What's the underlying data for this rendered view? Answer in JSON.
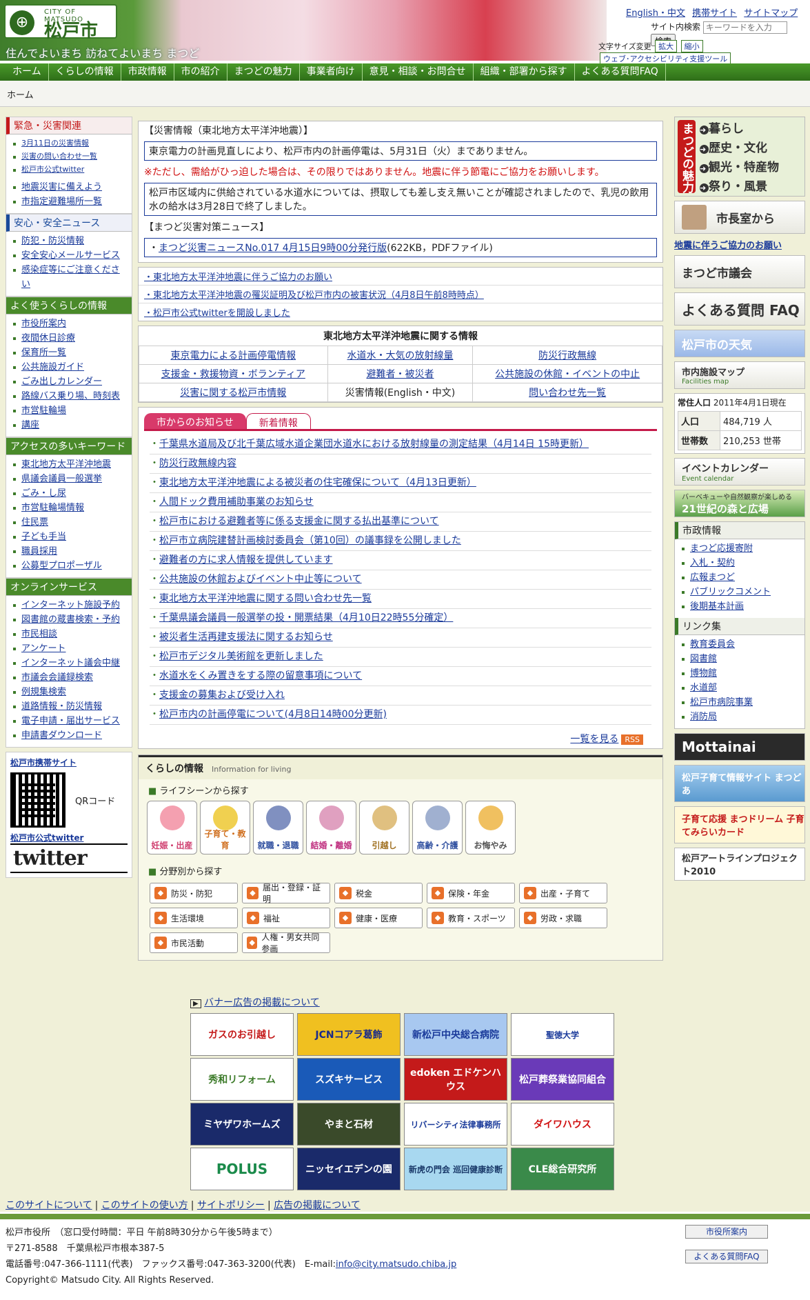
{
  "header": {
    "city_en": "CITY OF MATSUDO",
    "city_jp": "松戸市",
    "catch": "住んでよいまち 訪ねてよいまち まつど",
    "topnav": [
      "English・中文",
      "携帯サイト",
      "サイトマップ"
    ],
    "search_label": "サイト内検索",
    "search_placeholder": "キーワードを入力",
    "search_btn": "検索",
    "font_label": "文字サイズ変更",
    "font_up": "拡大",
    "font_down": "縮小",
    "access_btn": "ウェブ･アクセシビリティ支援ツール"
  },
  "gnav": [
    "ホーム",
    "くらしの情報",
    "市政情報",
    "市の紹介",
    "まつどの魅力",
    "事業者向け",
    "意見・相談・お問合せ",
    "組織・部署から探す",
    "よくある質問FAQ"
  ],
  "breadcrumb": "ホーム",
  "left": {
    "emergency": {
      "title": "緊急・災害関連",
      "items": [
        "3月11日の災害情報",
        "災害の問い合わせ一覧",
        "松戸市公式twitter"
      ],
      "items2": [
        "地震災害に備えよう",
        "市指定避難場所一覧"
      ]
    },
    "safety": {
      "title": "安心・安全ニュース",
      "items": [
        "防犯・防災情報",
        "安全安心メールサービス",
        "感染症等にご注意ください"
      ]
    },
    "often": {
      "title": "よく使うくらしの情報",
      "items": [
        "市役所案内",
        "夜間休日診療",
        "保育所一覧",
        "公共施設ガイド",
        "ごみ出しカレンダー",
        "路線バス乗り場、時刻表",
        "市営駐輪場",
        "講座"
      ]
    },
    "keywords": {
      "title": "アクセスの多いキーワード",
      "items": [
        "東北地方太平洋沖地震",
        "県議会議員一般選挙",
        "ごみ・し尿",
        "市営駐輪場情報",
        "住民票",
        "子ども手当",
        "職員採用",
        "公募型プロポーザル"
      ]
    },
    "online": {
      "title": "オンラインサービス",
      "items": [
        "インターネット施設予約",
        "図書館の蔵書検索・予約",
        "市民相談",
        "アンケート",
        "インターネット議会中継",
        "市議会会議録検索",
        "例規集検索",
        "道路情報・防災情報",
        "電子申請・届出サービス",
        "申請書ダウンロード"
      ]
    },
    "mobile": {
      "title": "松戸市携帯サイト",
      "qr": "QRコード",
      "twitter_title": "松戸市公式twitter",
      "twitter_logo": "twitter"
    }
  },
  "disaster": {
    "head": "【災害情報（東北地方太平洋沖地震）】",
    "power": "東京電力の計画見直しにより、松戸市内の計画停電は、5月31日（火）までありません。",
    "warn": "※ただし、需給がひっ迫した場合は、その限りではありません。地震に伴う節電にご協力をお願いします。",
    "water": "松戸市区域内に供給されている水道水については、摂取しても差し支え無いことが確認されましたので、乳児の飲用水の給水は3月28日で終了しました。",
    "news_head": "【まつど災害対策ニュース】",
    "news_link": "まつど災害ニュースNo.017 4月15日9時00分発行版",
    "news_meta": "(622KB，PDFファイル)",
    "links": [
      "東北地方太平洋沖地震に伴うご協力のお願い",
      "東北地方太平洋沖地震の罹災証明及び松戸市内の被害状況（4月8日午前8時時点）",
      "松戸市公式twitterを開設しました"
    ]
  },
  "info_table": {
    "title": "東北地方太平洋沖地震に関する情報",
    "rows": [
      [
        "東京電力による計画停電情報",
        "水道水・大気の放射線量",
        "防災行政無線"
      ],
      [
        "支援金・救援物資・ボランティア",
        "避難者・被災者",
        "公共施設の休館・イベントの中止"
      ],
      [
        "災害に関する松戸市情報",
        "災害情報(English・中文)",
        "問い合わせ先一覧"
      ]
    ]
  },
  "news": {
    "tab1": "市からのお知らせ",
    "tab2": "新着情報",
    "items": [
      "千葉県水道局及び北千葉広域水道企業団水道水における放射線量の測定結果（4月14日 15時更新）",
      "防災行政無線内容",
      "東北地方太平洋沖地震による被災者の住宅確保について（4月13日更新）",
      "人間ドック費用補助事業のお知らせ",
      "松戸市における避難者等に係る支援金に関する払出基準について",
      "松戸市立病院建替計画検討委員会（第10回）の議事録を公開しました",
      "避難者の方に求人情報を提供しています",
      "公共施設の休館およびイベント中止等について",
      "東北地方太平洋沖地震に関する問い合わせ先一覧",
      "千葉県議会議員一般選挙の投・開票結果（4月10日22時55分確定）",
      "被災者生活再建支援法に関するお知らせ",
      "松戸市デジタル美術館を更新しました",
      "水道水をくみ置きをする際の留意事項について",
      "支援金の募集および受け入れ",
      "松戸市内の計画停電について(4月8日14時00分更新)"
    ],
    "more": "一覧を見る",
    "rss": "RSS"
  },
  "kurashi": {
    "title": "くらしの情報",
    "sub": "Information for living",
    "life_head": "ライフシーンから探す",
    "life": [
      "妊娠・出産",
      "子育て・教育",
      "就職・退職",
      "結婚・離婚",
      "引越し",
      "高齢・介護",
      "お悔やみ"
    ],
    "cat_head": "分野別から探す",
    "cats": [
      "防災・防犯",
      "届出・登録・証明",
      "税金",
      "保険・年金",
      "出産・子育て",
      "生活環境",
      "福祉",
      "健康・医療",
      "教育・スポーツ",
      "労政・求職",
      "市民活動",
      "人権・男女共同参画"
    ]
  },
  "right": {
    "miryoku_label": "まつどの魅力",
    "miryoku": [
      "暮らし",
      "歴史・文化",
      "観光・特産物",
      "祭り・風景"
    ],
    "mayor": "市長室から",
    "notice": "地震に伴うご協力のお願い",
    "council": "まつど市議会",
    "faq": "よくある質問 FAQ",
    "weather": "松戸市の天気",
    "map": "市内施設マップ",
    "map_en": "Facilities map",
    "pop": {
      "label": "常住人口",
      "date": "2011年4月1日現在",
      "r1": [
        "人口",
        "484,719 人"
      ],
      "r2": [
        "世帯数",
        "210,253 世帯"
      ]
    },
    "event": "イベントカレンダー",
    "event_en": "Event calendar",
    "forest_sub": "バーベキューや自然観察が楽しめる",
    "forest": "21世紀の森と広場",
    "shisei": {
      "title": "市政情報",
      "items": [
        "まつど応援寄附",
        "入札・契約",
        "広報まつど",
        "パブリックコメント",
        "後期基本計画"
      ]
    },
    "links": {
      "title": "リンク集",
      "items": [
        "教育委員会",
        "図書館",
        "博物館",
        "水道部",
        "松戸市病院事業",
        "消防局"
      ]
    },
    "b1": "Mottainai",
    "b2": "松戸子育て情報サイト まつどあ",
    "b3": "子育て応援 まつドリーム 子育てみらいカード",
    "b4": "松戸アートラインプロジェクト2010"
  },
  "ads": {
    "title": "バナー広告の掲載について",
    "items": [
      "ガスのお引越し",
      "JCNコアラ葛飾",
      "新松戸中央総合病院",
      "聖徳大学",
      "秀和リフォーム",
      "スズキサービス",
      "edoken エドケンハウス",
      "松戸葬祭業協同組合",
      "ミヤザワホームズ",
      "やまと石材",
      "リバーシティ法律事務所",
      "ダイワハウス",
      "POLUS",
      "ニッセイエデンの園",
      "新虎の門会 巡回健康診断",
      "CLE総合研究所"
    ]
  },
  "footer": {
    "links": [
      "このサイトについて",
      "このサイトの使い方",
      "サイトポリシー",
      "広告の掲載について"
    ],
    "line1": "松戸市役所　（窓口受付時間：平日 午前8時30分から午後5時まで）",
    "line2": "〒271-8588　千葉県松戸市根本387-5",
    "line3": "電話番号:047-366-1111(代表)　ファックス番号:047-363-3200(代表)　E-mail:",
    "email": "info@city.matsudo.chiba.jp",
    "copy": "Copyright© Matsudo City. All Rights Reserved.",
    "btn1": "市役所案内",
    "btn2": "よくある質問FAQ"
  }
}
